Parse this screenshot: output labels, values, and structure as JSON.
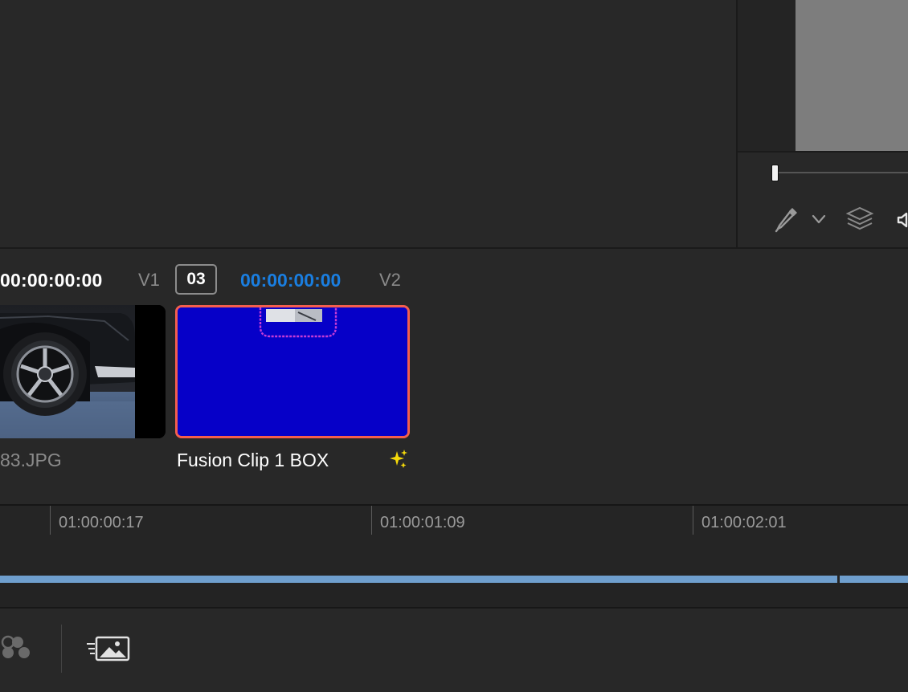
{
  "viewer": {
    "tools": [
      "eyedropper-icon",
      "chevron-down-icon",
      "layers-icon",
      "audio-icon"
    ]
  },
  "clips_header": {
    "left_timecode": "00:00:00:00",
    "left_track": "V1",
    "clip_number": "03",
    "right_timecode": "00:00:00:00",
    "right_track": "V2"
  },
  "clips": [
    {
      "name": "83.JPG",
      "selected": false,
      "thumbnail": "car-wheel-photo"
    },
    {
      "name": "Fusion Clip 1 BOX",
      "selected": true,
      "thumbnail": "blue-fusion-box",
      "badge": "sparkle-icon"
    }
  ],
  "timeline": {
    "ticks": [
      "01:00:00:17",
      "01:00:01:09",
      "01:00:02:01"
    ],
    "track_color": "#6f9fce"
  },
  "colors": {
    "accent_timecode": "#1a7ee0",
    "selected_border": "#f45e4e",
    "fusion_blue": "#0600c8",
    "sparkle": "#f5d90a"
  },
  "bottom_toolbar": {
    "icons": [
      "effects-icon",
      "image-sequence-icon"
    ]
  }
}
